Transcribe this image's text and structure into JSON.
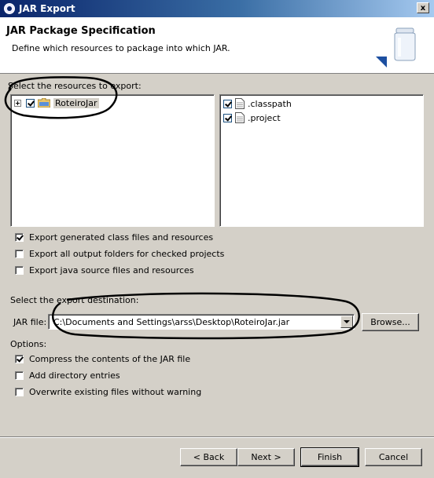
{
  "window": {
    "title": "JAR Export",
    "close_label": "x"
  },
  "banner": {
    "title": "JAR Package Specification",
    "description": "Define which resources to package into which JAR."
  },
  "resources": {
    "label": "Select the resources to export:",
    "tree": [
      {
        "label": "RoteiroJar",
        "checked": true,
        "expanded": false
      }
    ],
    "files": [
      {
        "label": ".classpath",
        "checked": true
      },
      {
        "label": ".project",
        "checked": true
      }
    ]
  },
  "export_options": [
    {
      "label": "Export generated class files and resources",
      "checked": true
    },
    {
      "label": "Export all output folders for checked projects",
      "checked": false
    },
    {
      "label": "Export java source files and resources",
      "checked": false
    }
  ],
  "destination": {
    "label": "Select the export destination:",
    "jar_file_label": "JAR file:",
    "jar_file_value": "C:\\Documents and Settings\\arss\\Desktop\\RoteiroJar.jar",
    "browse_label": "Browse..."
  },
  "options": {
    "label": "Options:",
    "items": [
      {
        "label": "Compress the contents of the JAR file",
        "checked": true
      },
      {
        "label": "Add directory entries",
        "checked": false
      },
      {
        "label": "Overwrite existing files without warning",
        "checked": false
      }
    ]
  },
  "buttons": {
    "back": "< Back",
    "next": "Next >",
    "finish": "Finish",
    "cancel": "Cancel"
  },
  "colors": {
    "title_gradient_start": "#0a246a",
    "dialog_bg": "#d4d0c8",
    "annotation": "#000000"
  }
}
